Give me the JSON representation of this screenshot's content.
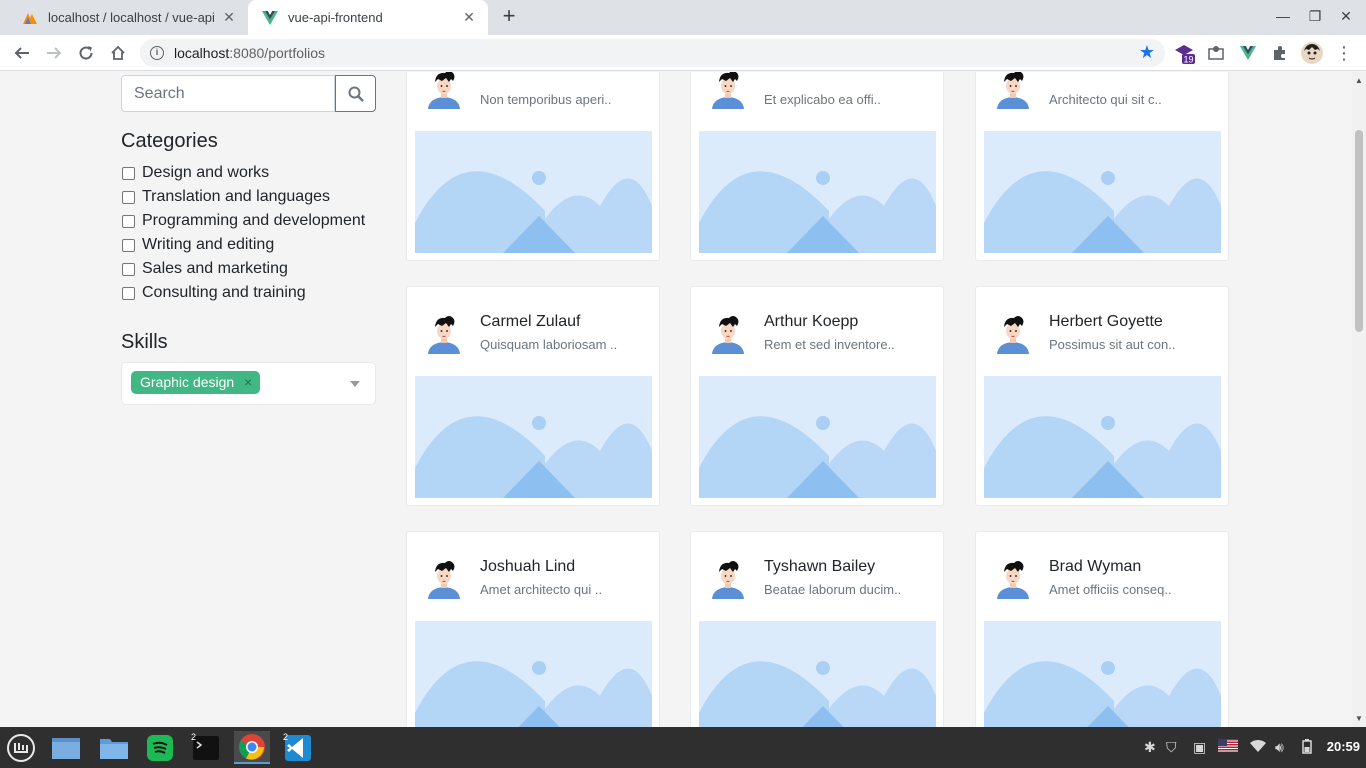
{
  "browser": {
    "tabs": [
      {
        "title": "localhost / localhost / vue-api",
        "favicon": "phpmyadmin-icon",
        "active": false
      },
      {
        "title": "vue-api-frontend",
        "favicon": "vue-icon",
        "active": true
      }
    ],
    "url_host": "localhost",
    "url_path": ":8080/portfolios",
    "extension_badge": "19"
  },
  "sidebar": {
    "search_placeholder": "Search",
    "categories_title": "Categories",
    "categories": [
      "Design and works",
      "Translation and languages",
      "Programming and development",
      "Writing and editing",
      "Sales and marketing",
      "Consulting and training"
    ],
    "skills_title": "Skills",
    "selected_skill": "Graphic design",
    "chip_remove": "×"
  },
  "portfolios": [
    {
      "name": "",
      "desc": "Non temporibus aperi.."
    },
    {
      "name": "",
      "desc": "Et explicabo ea offi.."
    },
    {
      "name": "",
      "desc": "Architecto qui sit c.."
    },
    {
      "name": "Carmel Zulauf",
      "desc": "Quisquam laboriosam .."
    },
    {
      "name": "Arthur Koepp",
      "desc": "Rem et sed inventore.."
    },
    {
      "name": "Herbert Goyette",
      "desc": "Possimus sit aut con.."
    },
    {
      "name": "Joshuah Lind",
      "desc": "Amet architecto qui .."
    },
    {
      "name": "Tyshawn Bailey",
      "desc": "Beatae laborum ducim.."
    },
    {
      "name": "Brad Wyman",
      "desc": "Amet officiis conseq.."
    }
  ],
  "taskbar": {
    "apps": [
      {
        "name": "mint-menu-icon"
      },
      {
        "name": "files-icon"
      },
      {
        "name": "folder-icon"
      },
      {
        "name": "spotify-icon"
      },
      {
        "name": "terminal-icon",
        "badge": "2"
      },
      {
        "name": "chrome-icon",
        "active": true
      },
      {
        "name": "vscode-icon",
        "badge": "2"
      }
    ],
    "clock": "20:59"
  },
  "colors": {
    "accent_green": "#41b883",
    "star_blue": "#1a73e8",
    "placeholder_bg": "#dcebfb",
    "placeholder_shape": "#a9cff5"
  }
}
